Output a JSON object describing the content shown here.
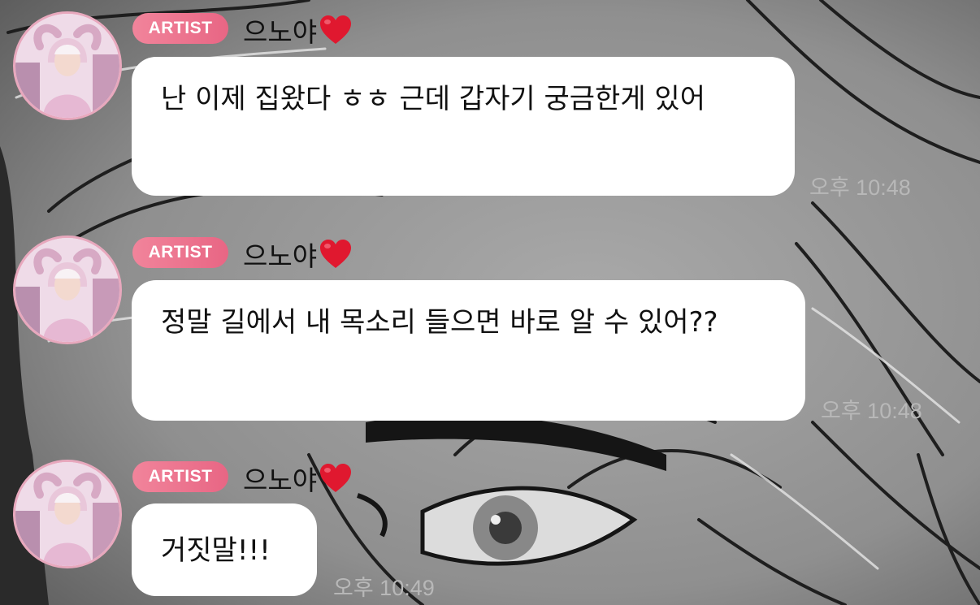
{
  "messages": [
    {
      "badge": "ARTIST",
      "sender": "으노야",
      "text": "난 이제 집왔다 ㅎㅎ 근데 갑자기 궁금한게 있어",
      "time": "오후 10:48"
    },
    {
      "badge": "ARTIST",
      "sender": "으노야",
      "text": "정말 길에서 내 목소리 들으면 바로 알 수 있어??",
      "time": "오후 10:48"
    },
    {
      "badge": "ARTIST",
      "sender": "으노야",
      "text": "거짓말!!!",
      "time": "오후 10:49"
    }
  ],
  "icons": {
    "heart": "red-heart-emoji",
    "avatar": "profile-photo"
  },
  "colors": {
    "badge": "#e86684",
    "avatar_ring": "#e8a8bd",
    "bubble": "#ffffff",
    "heart": "#e0182f",
    "timestamp": "#b8b8b8"
  }
}
